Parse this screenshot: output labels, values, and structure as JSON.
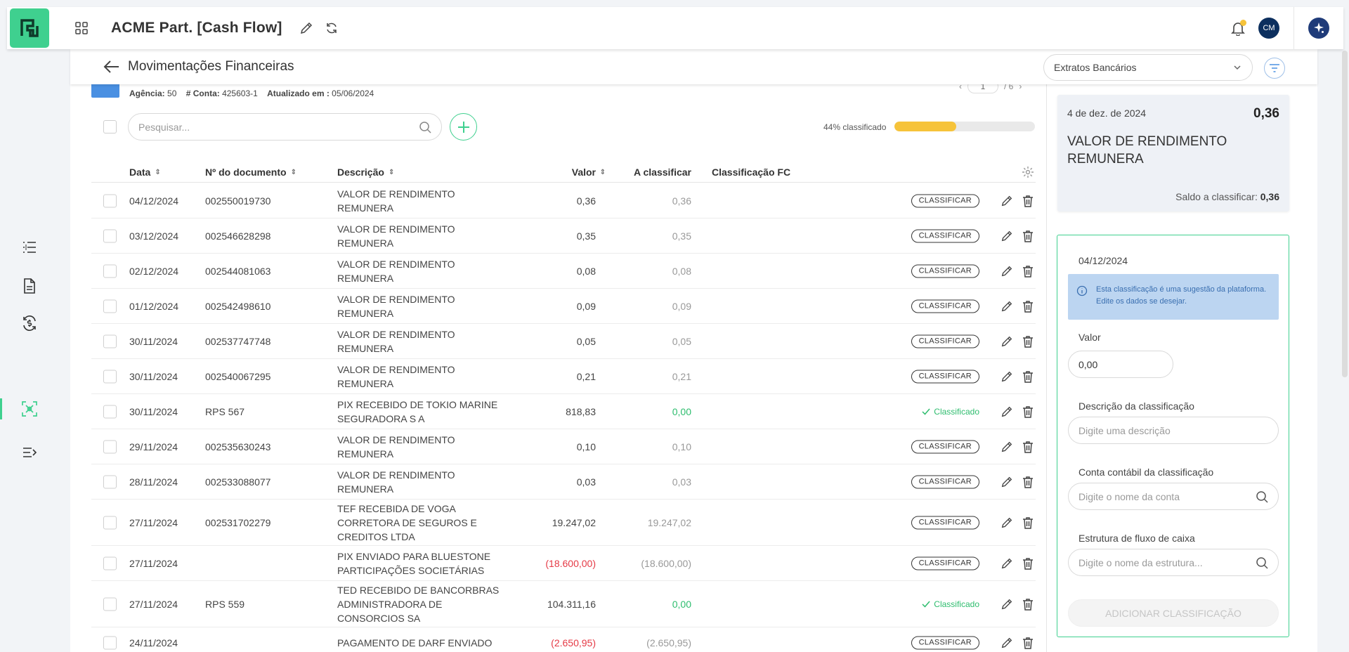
{
  "app": {
    "title": "ACME Part. [Cash Flow]",
    "avatar_initials": "CM"
  },
  "page": {
    "title": "Movimentações Financeiras",
    "statement_select": "Extratos Bancários",
    "bank": {
      "agencia_label": "Agência:",
      "agencia": "50",
      "conta_label": "# Conta:",
      "conta": "425603-1",
      "atualizado_label": "Atualizado em :",
      "atualizado": "05/06/2024"
    },
    "pager": {
      "current": "1",
      "total": "/ 6"
    },
    "search_placeholder": "Pesquisar...",
    "progress": {
      "label": "44% classificado",
      "percent": 44
    }
  },
  "table": {
    "headers": {
      "data": "Data",
      "doc": "Nº do documento",
      "desc": "Descrição",
      "valor": "Valor",
      "a_classificar": "A classificar",
      "class_fc": "Classificação FC"
    },
    "classify_label": "CLASSIFICAR",
    "classified_label": "Classificado",
    "rows": [
      {
        "date": "04/12/2024",
        "doc": "002550019730",
        "desc": "VALOR DE RENDIMENTO REMUNERA",
        "valor": "0,36",
        "acl": "0,36",
        "status": "pending",
        "neg": false
      },
      {
        "date": "03/12/2024",
        "doc": "002546628298",
        "desc": "VALOR DE RENDIMENTO REMUNERA",
        "valor": "0,35",
        "acl": "0,35",
        "status": "pending",
        "neg": false
      },
      {
        "date": "02/12/2024",
        "doc": "002544081063",
        "desc": "VALOR DE RENDIMENTO REMUNERA",
        "valor": "0,08",
        "acl": "0,08",
        "status": "pending",
        "neg": false
      },
      {
        "date": "01/12/2024",
        "doc": "002542498610",
        "desc": "VALOR DE RENDIMENTO REMUNERA",
        "valor": "0,09",
        "acl": "0,09",
        "status": "pending",
        "neg": false
      },
      {
        "date": "30/11/2024",
        "doc": "002537747748",
        "desc": "VALOR DE RENDIMENTO REMUNERA",
        "valor": "0,05",
        "acl": "0,05",
        "status": "pending",
        "neg": false
      },
      {
        "date": "30/11/2024",
        "doc": "002540067295",
        "desc": "VALOR DE RENDIMENTO REMUNERA",
        "valor": "0,21",
        "acl": "0,21",
        "status": "pending",
        "neg": false
      },
      {
        "date": "30/11/2024",
        "doc": "RPS 567",
        "desc": "PIX RECEBIDO DE TOKIO MARINE SEGURADORA S A",
        "valor": "818,83",
        "acl": "0,00",
        "status": "classified",
        "neg": false
      },
      {
        "date": "29/11/2024",
        "doc": "002535630243",
        "desc": "VALOR DE RENDIMENTO REMUNERA",
        "valor": "0,10",
        "acl": "0,10",
        "status": "pending",
        "neg": false
      },
      {
        "date": "28/11/2024",
        "doc": "002533088077",
        "desc": "VALOR DE RENDIMENTO REMUNERA",
        "valor": "0,03",
        "acl": "0,03",
        "status": "pending",
        "neg": false
      },
      {
        "date": "27/11/2024",
        "doc": "002531702279",
        "desc": "TEF RECEBIDA DE VOGA CORRETORA DE SEGUROS E CREDITOS LTDA",
        "valor": "19.247,02",
        "acl": "19.247,02",
        "status": "pending",
        "neg": false
      },
      {
        "date": "27/11/2024",
        "doc": "",
        "desc": "PIX ENVIADO PARA BLUESTONE PARTICIPAÇÕES SOCIETÁRIAS",
        "valor": "(18.600,00)",
        "acl": "(18.600,00)",
        "status": "pending",
        "neg": true
      },
      {
        "date": "27/11/2024",
        "doc": "RPS 559",
        "desc": "TED RECEBIDO DE BANCORBRAS ADMINISTRADORA DE CONSORCIOS SA",
        "valor": "104.311,16",
        "acl": "0,00",
        "status": "classified",
        "neg": false
      },
      {
        "date": "24/11/2024",
        "doc": "",
        "desc": "PAGAMENTO DE DARF ENVIADO",
        "valor": "(2.650,95)",
        "acl": "(2.650,95)",
        "status": "pending",
        "neg": true
      }
    ]
  },
  "summary": {
    "date": "4 de dez. de 2024",
    "value": "0,36",
    "desc": "VALOR DE RENDIMENTO REMUNERA",
    "saldo_label": "Saldo a classificar:",
    "saldo": "0,36"
  },
  "form": {
    "date": "04/12/2024",
    "info": "Esta classificação é uma sugestão da plataforma. Edite os dados se desejar.",
    "valor_label": "Valor",
    "valor": "0,00",
    "desc_label": "Descrição da classificação",
    "desc_placeholder": "Digite uma descrição",
    "conta_label": "Conta contábil da classificação",
    "conta_placeholder": "Digite o nome da conta",
    "estrutura_label": "Estrutura de fluxo de caixa",
    "estrutura_placeholder": "Digite o nome da estrutura...",
    "submit": "ADICIONAR CLASSIFICAÇÃO"
  },
  "colors": {
    "brand": "#3fd08f",
    "progress": "#f6c33a",
    "negative": "#e53945",
    "info_bg": "#bcd5f1"
  }
}
